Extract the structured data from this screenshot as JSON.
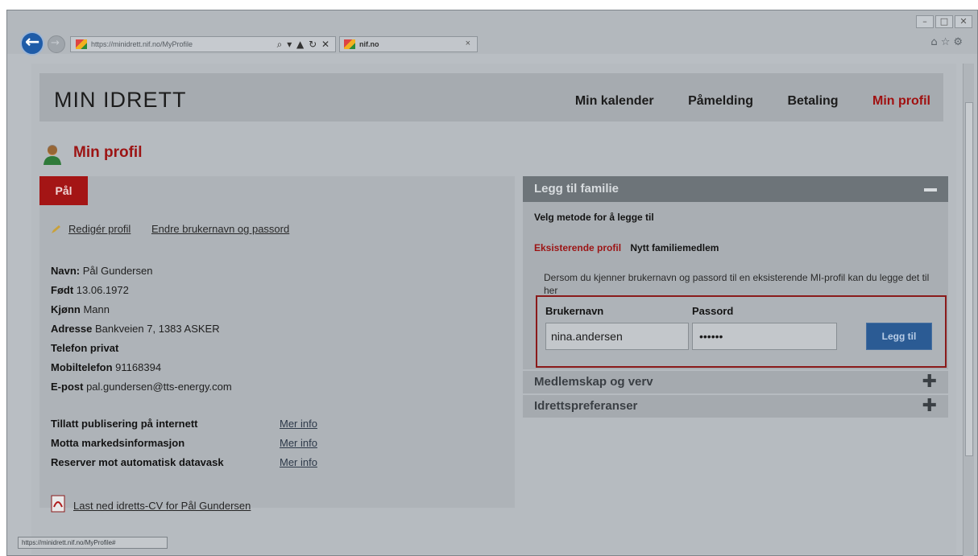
{
  "browser": {
    "url": "https://minidrett.nif.no/MyProfile",
    "address_icons": "⌕ ▾ ▲ ↻ ✕",
    "tab_title": "nif.no",
    "tab_close": "×",
    "status_url": "https://minidrett.nif.no/MyProfile#"
  },
  "site": {
    "logo": "MIN IDRETT",
    "nav": [
      "Min kalender",
      "Påmelding",
      "Betaling",
      "Min profil"
    ],
    "active_nav": "Min profil"
  },
  "page_title": "Min profil",
  "profile": {
    "name_tab": "Pål",
    "edit_link": "Redigér profil",
    "change_link": "Endre brukernavn og passord",
    "fields": [
      {
        "label": "Navn:",
        "value": "Pål Gundersen"
      },
      {
        "label": "Født",
        "value": "13.06.1972"
      },
      {
        "label": "Kjønn",
        "value": "Mann"
      },
      {
        "label": "Adresse",
        "value": "Bankveien 7, 1383 ASKER"
      },
      {
        "label": "Telefon privat",
        "value": ""
      },
      {
        "label": "Mobiltelefon",
        "value": "91168394"
      },
      {
        "label": "E-post",
        "value": "pal.gundersen@tts-energy.com"
      }
    ],
    "settings": [
      {
        "label": "Tillatt publisering på internett",
        "link": "Mer info"
      },
      {
        "label": "Motta markedsinformasjon",
        "link": "Mer info"
      },
      {
        "label": "Reserver mot automatisk datavask",
        "link": "Mer info"
      }
    ],
    "cv_link": "Last ned idretts-CV for Pål Gundersen"
  },
  "family": {
    "header": "Legg til familie",
    "method_title": "Velg metode for å legge til",
    "method_selected": "Eksisterende profil",
    "method_other": "Nytt familiemedlem",
    "description": "Dersom du kjenner brukernavn og passord til en eksisterende MI-profil kan du legge det til her",
    "username_label": "Brukernavn",
    "password_label": "Passord",
    "username_value": "nina.andersen",
    "password_value": "••••••",
    "add_button": "Legg til"
  },
  "accordion": [
    {
      "label": "Medlemskap og verv"
    },
    {
      "label": "Idrettspreferanser"
    }
  ],
  "colors": {
    "accent_red": "#a41515",
    "button_blue": "#2b5b94"
  }
}
